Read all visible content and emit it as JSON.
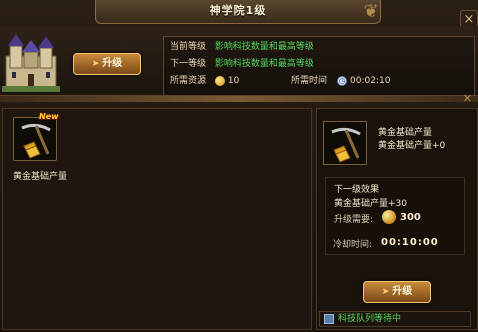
{
  "window": {
    "title": "神学院1级",
    "close_label": "×"
  },
  "building": {
    "upgrade_label": "升级"
  },
  "info": {
    "current_label": "当前等级",
    "current_value": "影响科技数量和最高等级",
    "next_label": "下一等级",
    "next_value": "影响科技数量和最高等级",
    "resource_label": "所需资源",
    "resource_value": "10",
    "time_label": "所需时间",
    "time_value": "00:02:10"
  },
  "tech_list": [
    {
      "name": "黄金基础产量",
      "badge": "New"
    }
  ],
  "detail": {
    "name": "黄金基础产量",
    "current_effect": "黄金基础产量+0",
    "next_effect_title": "下一级效果",
    "next_effect": "黄金基础产量+30",
    "cost_label": "升级需要:",
    "cost_value": "300",
    "cooldown_label": "冷却时间:",
    "cooldown_value": "00:10:00",
    "upgrade_label": "升级",
    "queue_status": "科技队列等待中"
  },
  "colors": {
    "accent_green": "#53d65a",
    "gold": "#c88c18",
    "frame": "#2a1f15"
  },
  "icons": [
    "castle-icon",
    "pickaxe-gold-icon",
    "coin-icon",
    "clock-icon",
    "close-icon",
    "queue-icon",
    "arrow-icon"
  ]
}
